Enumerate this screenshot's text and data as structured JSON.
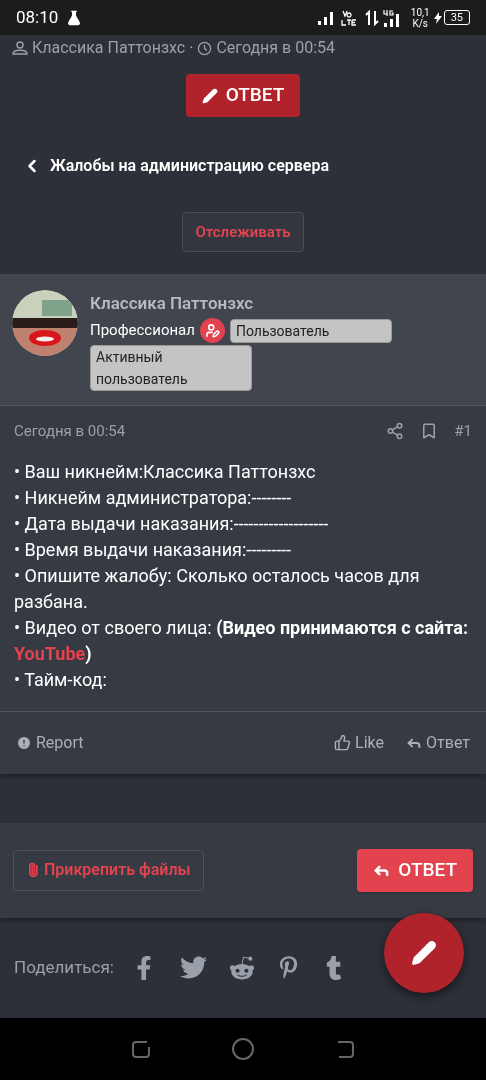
{
  "status_bar": {
    "time": "08:10",
    "network_speed": "10,1\nK/s",
    "battery": "35"
  },
  "thread_meta": {
    "author": "Классика Паттонзхс",
    "separator": "·",
    "date": "Сегодня в 00:54"
  },
  "top_reply_button": "ОТВЕТ",
  "breadcrumb": "Жалобы на администрацию сервера",
  "watch_button": "Отслеживать",
  "post": {
    "author": "Классика Паттонзхс",
    "title": "Профессионал",
    "badges": [
      "Пользователь",
      "Активный пользователь"
    ],
    "date": "Сегодня в 00:54",
    "number": "#1",
    "lines": [
      {
        "text": "• Ваш никнейм:Классика Паттонзхс"
      },
      {
        "text": "• Никнейм администратора:--------"
      },
      {
        "text": "• Дата выдачи наказания:-------------------"
      },
      {
        "text": "• Время выдачи наказания:---------"
      },
      {
        "text": "• Опишите жалобу: Сколько осталось часов для разбана."
      },
      {
        "text": "• Видео от своего лица: **(Видео принимаются с сайта:** ",
        "link": "YouTube",
        "after": ")"
      },
      {
        "text": "• Тайм-код:"
      }
    ],
    "actions": {
      "report": "Report",
      "like": "Like",
      "reply": "Ответ"
    }
  },
  "attach_button": "Прикрепить файлы",
  "reply_button": "ОТВЕТ",
  "share_label": "Поделиться:"
}
